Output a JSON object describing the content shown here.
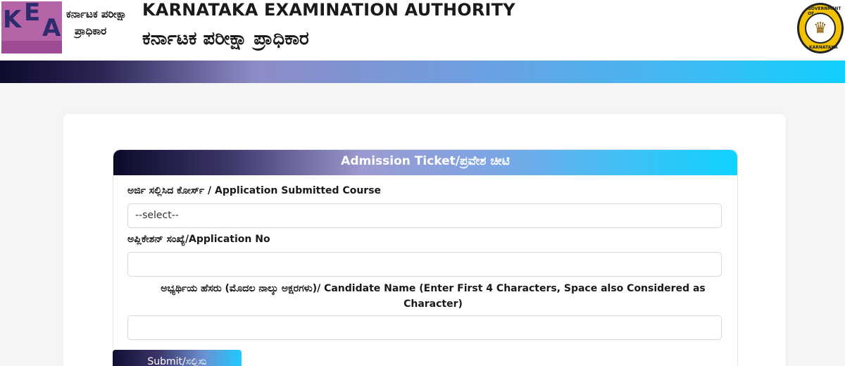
{
  "header": {
    "logo_letters": [
      "K",
      "E",
      "A"
    ],
    "logo_kn_line1": "ಕರ್ನಾಟಕ ಪರೀಕ್ಷಾ",
    "logo_kn_line2": "ಪ್ರಾಧಿಕಾರ",
    "title_en": "KARNATAKA EXAMINATION AUTHORITY",
    "title_kn": "ಕರ್ನಾಟಕ ಪರೀಕ್ಷಾ ಪ್ರಾಧಿಕಾರ",
    "emblem_top": "GOVERNMENT OF",
    "emblem_bottom": "KARNATAKA"
  },
  "form": {
    "panel_title": "Admission Ticket/ಪ್ರವೇಶ ಚೀಟಿ",
    "course_label": "ಅರ್ಜಿ ಸಲ್ಲಿಸಿದ ಕೋರ್ಸ್ / Application Submitted Course",
    "course_value": "--select--",
    "app_no_label": "ಅಪ್ಲಿಕೇಶನ್ ಸಂಖ್ಯೆ/Application No",
    "app_no_value": "",
    "name_label": "ಅಭ್ಯರ್ಥಿಯ ಹೆಸರು (ಮೊದಲ ನಾಲ್ಕು ಅಕ್ಷರಗಳು)/ Candidate Name (Enter First 4 Characters, Space also Considered as Character)",
    "name_value": "",
    "submit_label": "Submit/ಸಲ್ಲಿಸು"
  },
  "colors": {
    "gradient_start": "#0d0a2e",
    "gradient_mid": "#8d8bc6",
    "gradient_end": "#11d0ff",
    "logo_bg": "#b565a7",
    "logo_text": "#2d2a6e"
  }
}
